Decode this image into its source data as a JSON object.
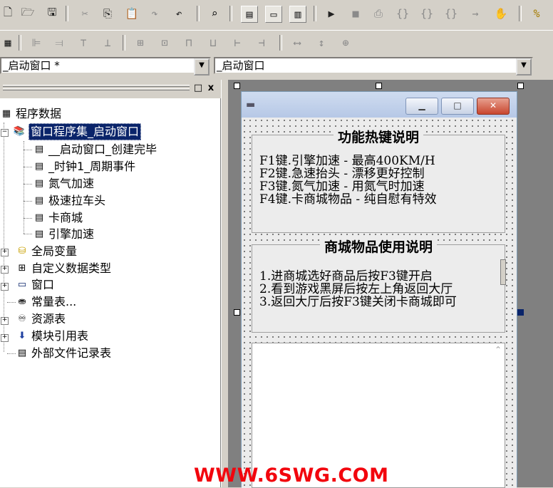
{
  "toolbar1": {
    "icons": [
      "new-icon",
      "open-folder-icon",
      "save-icon",
      "cut-icon",
      "copy-icon",
      "paste-icon",
      "redo-icon",
      "undo-icon",
      "find-icon",
      "layout1-icon",
      "layout2-icon",
      "layout3-icon",
      "run-icon",
      "stop-icon",
      "step-icon",
      "step-into-icon",
      "step-over-icon",
      "step-out-icon",
      "run-to-cursor-icon",
      "hand-icon",
      "find-replace-icon"
    ]
  },
  "toolbar2": {
    "icons": [
      "align-grid-icon",
      "align-left-icon",
      "align-right-icon",
      "align-top-icon",
      "align-bottom-icon",
      "center-horizontal-icon",
      "center-vertical-icon",
      "same-width-icon",
      "same-height-icon",
      "same-size-icon",
      "space-icon",
      "spread-h-icon",
      "spread-v-icon",
      "fit-icon"
    ]
  },
  "combo_left": {
    "value": "_启动窗口 *"
  },
  "combo_right": {
    "value": "_启动窗口"
  },
  "panel_controls": {
    "restore": "□",
    "close": "x"
  },
  "tree": {
    "root": "程序数据",
    "assembly": "窗口程序集_启动窗口",
    "subs": [
      "__启动窗口_创建完毕",
      "_时钟1_周期事件",
      "氮气加速",
      "极速拉车头",
      "卡商城",
      "引擎加速"
    ],
    "items": [
      "全局变量",
      "自定义数据类型",
      "窗口",
      "常量表...",
      "资源表",
      "模块引用表",
      "外部文件记录表"
    ]
  },
  "form": {
    "group1_title": "功能热键说明",
    "group1_lines": [
      "F1键.引擎加速   -  最高400KM/H",
      "F2键.急速抬头   -  漂移更好控制",
      "F3键.氮气加速   -  用氮气时加速",
      "F4键.卡商城物品 -  纯自慰有特效"
    ],
    "group2_title": "商城物品使用说明",
    "group2_lines": [
      "1.进商城选好商品后按F3键开启",
      "2.看到游戏黑屏后按左上角返回大厅",
      "3.返回大厅后按F3键关闭卡商城即可"
    ]
  },
  "watermark": "WWW.6SWG.COM"
}
